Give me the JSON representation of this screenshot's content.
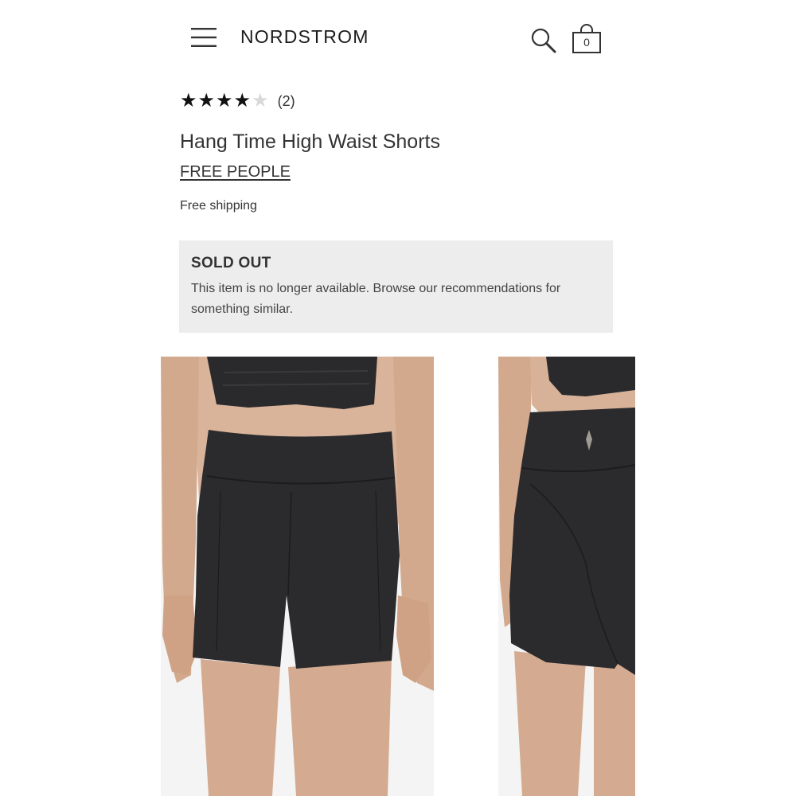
{
  "header": {
    "logo": "NORDSTROM",
    "bag_count": "0"
  },
  "product": {
    "rating": 4,
    "rating_max": 5,
    "review_count": "(2)",
    "title": "Hang Time High Waist Shorts",
    "brand": "FREE PEOPLE",
    "shipping": "Free shipping"
  },
  "availability": {
    "status": "SOLD OUT",
    "message": "This item is no longer available. Browse our recommendations for something similar."
  },
  "images": [
    {
      "view": "front"
    },
    {
      "view": "back"
    }
  ],
  "colors": {
    "text": "#333333",
    "banner_bg": "#ededed",
    "star_filled": "#111111",
    "star_empty": "#d9d9d9"
  }
}
